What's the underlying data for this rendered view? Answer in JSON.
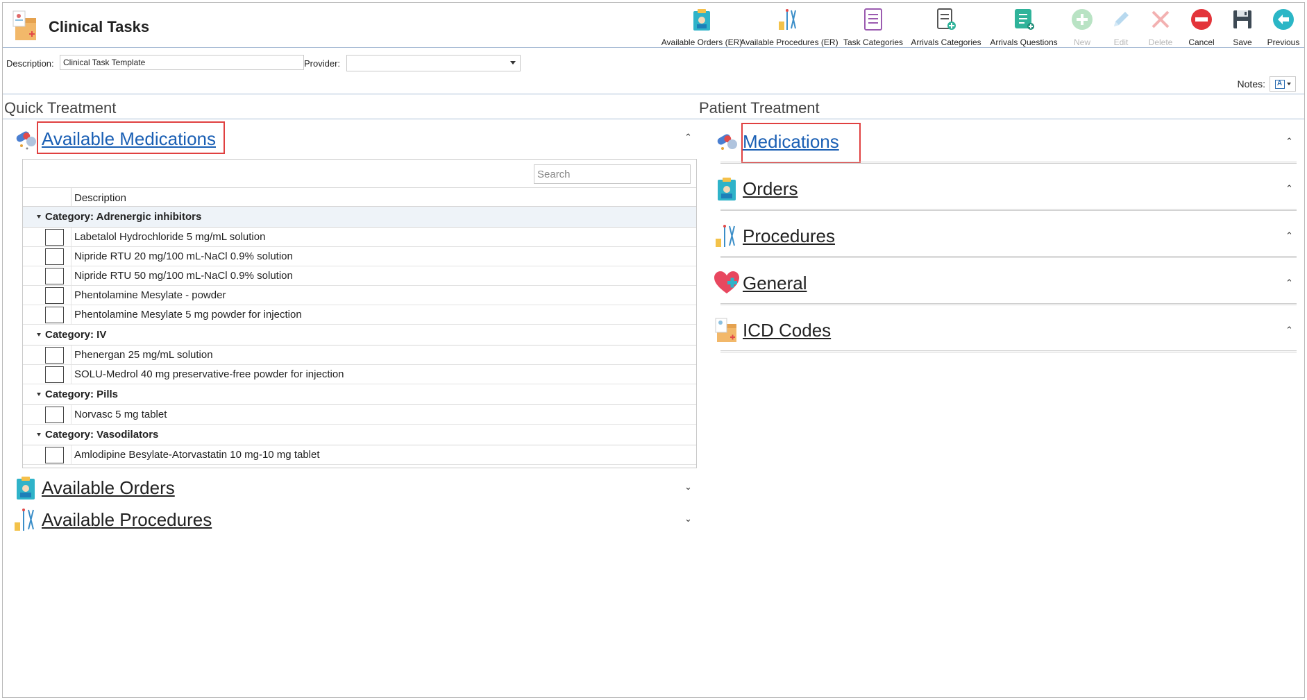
{
  "header": {
    "title": "Clinical Tasks",
    "toolbar": [
      {
        "label": "Available Orders (ER)",
        "icon": "orders-clipboard-icon",
        "disabled": false
      },
      {
        "label": "Available Procedures (ER)",
        "icon": "procedures-instruments-icon",
        "disabled": false
      },
      {
        "label": "Task Categories",
        "icon": "task-categories-icon",
        "disabled": false
      },
      {
        "label": "Arrivals Categories",
        "icon": "arrivals-categories-icon",
        "disabled": false
      },
      {
        "label": "Arrivals Questions",
        "icon": "arrivals-questions-icon",
        "disabled": false
      },
      {
        "label": "New",
        "icon": "plus-circle-icon",
        "disabled": true
      },
      {
        "label": "Edit",
        "icon": "pencil-icon",
        "disabled": true
      },
      {
        "label": "Delete",
        "icon": "x-icon",
        "disabled": true
      },
      {
        "label": "Cancel",
        "icon": "cancel-circle-icon",
        "disabled": false
      },
      {
        "label": "Save",
        "icon": "floppy-disk-icon",
        "disabled": false
      },
      {
        "label": "Previous",
        "icon": "arrow-left-circle-icon",
        "disabled": false
      }
    ]
  },
  "form": {
    "description_label": "Description:",
    "description_value": "Clinical Task Template",
    "provider_label": "Provider:",
    "provider_value": "",
    "notes_label": "Notes:"
  },
  "quick_treatment": {
    "title": "Quick Treatment",
    "available_medications": "Available Medications",
    "available_orders": "Available Orders",
    "available_procedures": "Available Procedures",
    "search_placeholder": "Search",
    "column_description": "Description",
    "categories": [
      {
        "name": "Category: Adrenergic inhibitors",
        "items": [
          "Labetalol Hydrochloride 5 mg/mL solution",
          "Nipride RTU 20 mg/100 mL-NaCl 0.9% solution",
          "Nipride RTU 50 mg/100 mL-NaCl 0.9% solution",
          "Phentolamine Mesylate - powder",
          "Phentolamine Mesylate 5 mg powder for injection"
        ]
      },
      {
        "name": "Category: IV",
        "items": [
          "Phenergan 25 mg/mL solution",
          "SOLU-Medrol 40 mg preservative-free powder for injection"
        ]
      },
      {
        "name": "Category: Pills",
        "items": [
          "Norvasc 5 mg tablet"
        ]
      },
      {
        "name": "Category: Vasodilators",
        "items": [
          "Amlodipine Besylate-Atorvastatin 10 mg-10 mg tablet"
        ]
      }
    ]
  },
  "patient_treatment": {
    "title": "Patient Treatment",
    "sections": [
      "Medications",
      "Orders",
      "Procedures",
      "General",
      "ICD Codes"
    ]
  },
  "colors": {
    "link_blue": "#1a5fb4",
    "highlight_red": "#e04040",
    "header_line": "#a9bdd6"
  }
}
